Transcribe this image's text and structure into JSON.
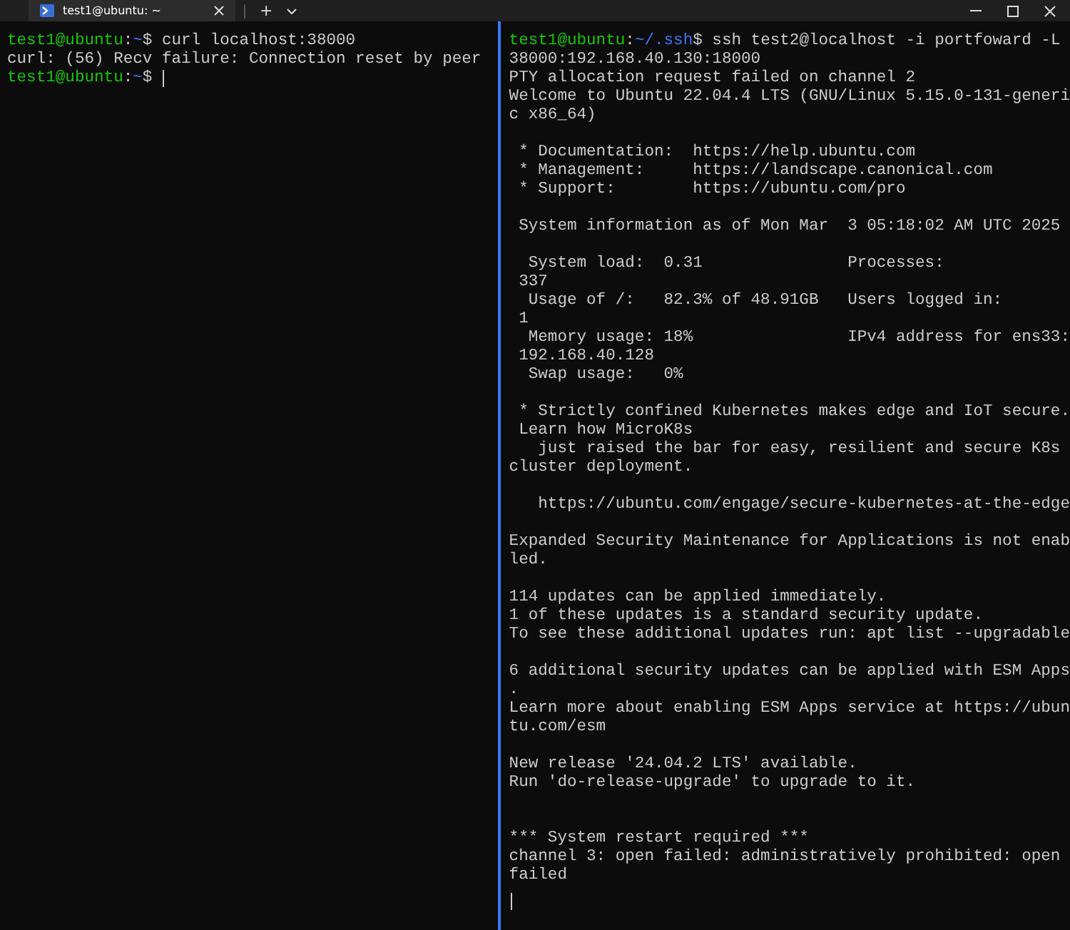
{
  "tab_bar": {
    "tabs": [
      {
        "title": "test1@ubuntu: ~",
        "selected": true
      }
    ],
    "new_tab": "+"
  },
  "panes": [
    {
      "focused": false,
      "lines": [
        {
          "kind": "text",
          "segments": [
            {
              "kind": "user",
              "text": "test1@ubuntu"
            },
            {
              "kind": "plain",
              "text": ":"
            },
            {
              "kind": "path",
              "text": "~"
            },
            {
              "kind": "plain",
              "text": "$ curl localhost:38000"
            }
          ]
        },
        {
          "kind": "text",
          "segments": [
            {
              "kind": "plain",
              "text": "curl: (56) Recv failure: Connection reset by peer"
            }
          ]
        },
        {
          "kind": "text",
          "cursor": true,
          "segments": [
            {
              "kind": "user",
              "text": "test1@ubuntu"
            },
            {
              "kind": "plain",
              "text": ":"
            },
            {
              "kind": "path",
              "text": "~"
            },
            {
              "kind": "plain",
              "text": "$"
            }
          ]
        }
      ]
    },
    {
      "focused": true,
      "lines": [
        {
          "kind": "text",
          "segments": [
            {
              "kind": "user",
              "text": "test1@ubuntu"
            },
            {
              "kind": "plain",
              "text": ":"
            },
            {
              "kind": "path",
              "text": "~/.ssh"
            },
            {
              "kind": "plain",
              "text": "$ ssh test2@localhost -i portfoward -L"
            }
          ]
        },
        {
          "kind": "text",
          "segments": [
            {
              "kind": "plain",
              "text": "38000:192.168.40.130:18000"
            }
          ]
        },
        {
          "kind": "text",
          "segments": [
            {
              "kind": "plain",
              "text": "PTY allocation request failed on channel 2"
            }
          ]
        },
        {
          "kind": "text",
          "segments": [
            {
              "kind": "plain",
              "text": "Welcome to Ubuntu 22.04.4 LTS (GNU/Linux 5.15.0-131-generi"
            }
          ]
        },
        {
          "kind": "text",
          "segments": [
            {
              "kind": "plain",
              "text": "c x86_64)"
            }
          ]
        },
        {
          "kind": "blank"
        },
        {
          "kind": "text",
          "segments": [
            {
              "kind": "plain",
              "text": " * Documentation:  https://help.ubuntu.com"
            }
          ]
        },
        {
          "kind": "text",
          "segments": [
            {
              "kind": "plain",
              "text": " * Management:     https://landscape.canonical.com"
            }
          ]
        },
        {
          "kind": "text",
          "segments": [
            {
              "kind": "plain",
              "text": " * Support:        https://ubuntu.com/pro"
            }
          ]
        },
        {
          "kind": "blank"
        },
        {
          "kind": "text",
          "segments": [
            {
              "kind": "plain",
              "text": " System information as of Mon Mar  3 05:18:02 AM UTC 2025"
            }
          ]
        },
        {
          "kind": "blank"
        },
        {
          "kind": "text",
          "segments": [
            {
              "kind": "plain",
              "text": "  System load:  0.31               Processes:"
            }
          ]
        },
        {
          "kind": "text",
          "segments": [
            {
              "kind": "plain",
              "text": " 337"
            }
          ]
        },
        {
          "kind": "text",
          "segments": [
            {
              "kind": "plain",
              "text": "  Usage of /:   82.3% of 48.91GB   Users logged in:"
            }
          ]
        },
        {
          "kind": "text",
          "segments": [
            {
              "kind": "plain",
              "text": " 1"
            }
          ]
        },
        {
          "kind": "text",
          "segments": [
            {
              "kind": "plain",
              "text": "  Memory usage: 18%                IPv4 address for ens33:"
            }
          ]
        },
        {
          "kind": "text",
          "segments": [
            {
              "kind": "plain",
              "text": " 192.168.40.128"
            }
          ]
        },
        {
          "kind": "text",
          "segments": [
            {
              "kind": "plain",
              "text": "  Swap usage:   0%"
            }
          ]
        },
        {
          "kind": "blank"
        },
        {
          "kind": "text",
          "segments": [
            {
              "kind": "plain",
              "text": " * Strictly confined Kubernetes makes edge and IoT secure."
            }
          ]
        },
        {
          "kind": "text",
          "segments": [
            {
              "kind": "plain",
              "text": " Learn how MicroK8s"
            }
          ]
        },
        {
          "kind": "text",
          "segments": [
            {
              "kind": "plain",
              "text": "   just raised the bar for easy, resilient and secure K8s"
            }
          ]
        },
        {
          "kind": "text",
          "segments": [
            {
              "kind": "plain",
              "text": "cluster deployment."
            }
          ]
        },
        {
          "kind": "blank"
        },
        {
          "kind": "text",
          "segments": [
            {
              "kind": "plain",
              "text": "   https://ubuntu.com/engage/secure-kubernetes-at-the-edge"
            }
          ]
        },
        {
          "kind": "blank"
        },
        {
          "kind": "text",
          "segments": [
            {
              "kind": "plain",
              "text": "Expanded Security Maintenance for Applications is not enab"
            }
          ]
        },
        {
          "kind": "text",
          "segments": [
            {
              "kind": "plain",
              "text": "led."
            }
          ]
        },
        {
          "kind": "blank"
        },
        {
          "kind": "text",
          "segments": [
            {
              "kind": "plain",
              "text": "114 updates can be applied immediately."
            }
          ]
        },
        {
          "kind": "text",
          "segments": [
            {
              "kind": "plain",
              "text": "1 of these updates is a standard security update."
            }
          ]
        },
        {
          "kind": "text",
          "segments": [
            {
              "kind": "plain",
              "text": "To see these additional updates run: apt list --upgradable"
            }
          ]
        },
        {
          "kind": "blank"
        },
        {
          "kind": "text",
          "segments": [
            {
              "kind": "plain",
              "text": "6 additional security updates can be applied with ESM Apps"
            }
          ]
        },
        {
          "kind": "text",
          "segments": [
            {
              "kind": "plain",
              "text": "."
            }
          ]
        },
        {
          "kind": "text",
          "segments": [
            {
              "kind": "plain",
              "text": "Learn more about enabling ESM Apps service at https://ubun"
            }
          ]
        },
        {
          "kind": "text",
          "segments": [
            {
              "kind": "plain",
              "text": "tu.com/esm"
            }
          ]
        },
        {
          "kind": "blank"
        },
        {
          "kind": "text",
          "segments": [
            {
              "kind": "plain",
              "text": "New release '24.04.2 LTS' available."
            }
          ]
        },
        {
          "kind": "text",
          "segments": [
            {
              "kind": "plain",
              "text": "Run 'do-release-upgrade' to upgrade to it."
            }
          ]
        },
        {
          "kind": "blank"
        },
        {
          "kind": "blank"
        },
        {
          "kind": "text",
          "segments": [
            {
              "kind": "plain",
              "text": "*** System restart required ***"
            }
          ]
        },
        {
          "kind": "text",
          "segments": [
            {
              "kind": "plain",
              "text": "channel 3: open failed: administratively prohibited: open"
            }
          ]
        },
        {
          "kind": "text",
          "segments": [
            {
              "kind": "plain",
              "text": "failed"
            }
          ]
        },
        {
          "kind": "blank",
          "cursor": true
        }
      ]
    }
  ]
}
